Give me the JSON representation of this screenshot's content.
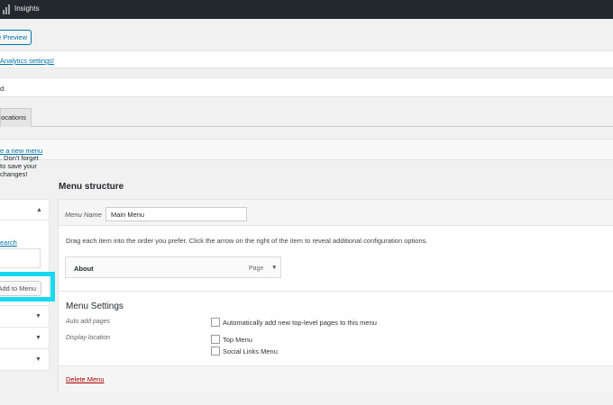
{
  "admin_bar": {
    "label": "Insights"
  },
  "header": {
    "preview_button": "e Preview"
  },
  "notices": {
    "analytics": "Analytics settings!",
    "updated": "d.",
    "menu_help_link": "e a new menu",
    "menu_help_rest": ". Don't forget to save your changes!"
  },
  "tabs": {
    "locations": "ocations"
  },
  "left": {
    "search_link": "earch",
    "add_button": "Add to Menu"
  },
  "menu_structure": {
    "title": "Menu structure",
    "menu_name_label": "Menu Name",
    "menu_name_value": "Main Menu",
    "instructions": "Drag each item into the order you prefer. Click the arrow on the right of the item to reveal additional configuration options.",
    "items": [
      {
        "title": "About",
        "type": "Page"
      }
    ]
  },
  "menu_settings": {
    "title": "Menu Settings",
    "auto_add_label": "Auto add pages",
    "auto_add_option": "Automatically add new top-level pages to this menu",
    "display_location_label": "Display location",
    "locations": [
      "Top Menu",
      "Social Links Menu"
    ]
  },
  "footer": {
    "delete_link": "Delete Menu"
  },
  "colors": {
    "highlight": "#18d8f0",
    "admin_bar": "#23282d",
    "link": "#0073aa",
    "delete": "#aa0000"
  }
}
